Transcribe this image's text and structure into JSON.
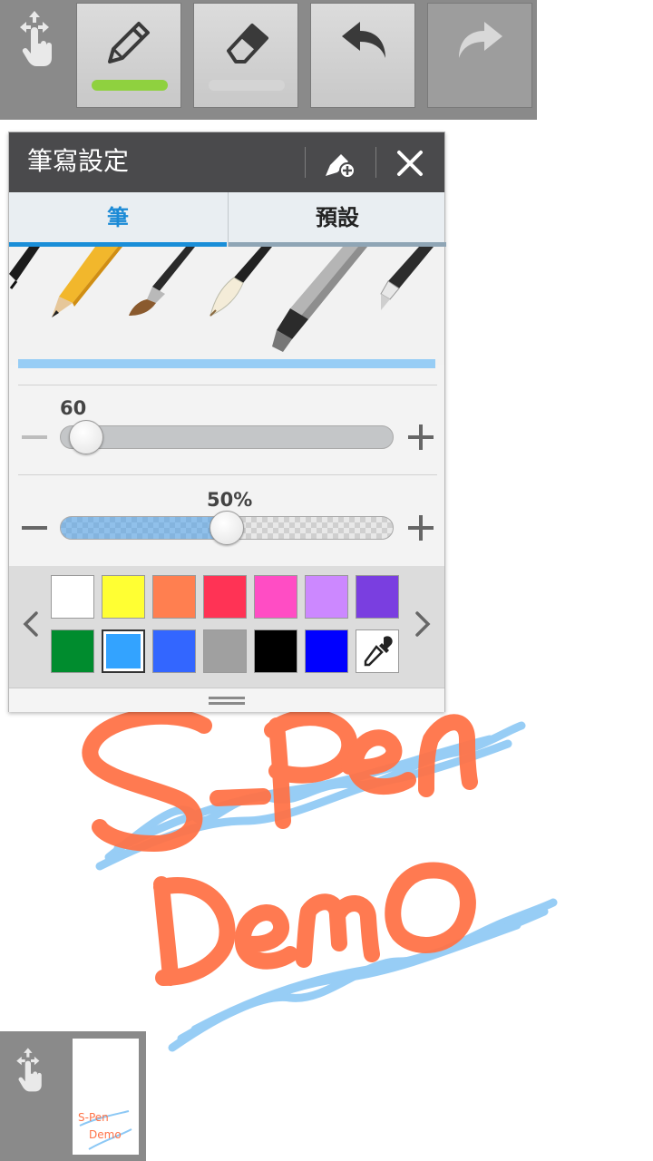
{
  "toolbar": {
    "items": [
      {
        "name": "move",
        "icon": "move-hand-icon"
      },
      {
        "name": "pen",
        "icon": "pencil-icon",
        "active": true,
        "indicator_color": "#8fd13f"
      },
      {
        "name": "eraser",
        "icon": "eraser-icon",
        "indicator_color": "#d4d4d4"
      },
      {
        "name": "undo",
        "icon": "undo-icon"
      },
      {
        "name": "redo",
        "icon": "redo-icon",
        "disabled": true
      }
    ]
  },
  "pen_panel": {
    "title": "筆寫設定",
    "header_icons": [
      "add-preset-icon",
      "close-icon"
    ],
    "tabs": [
      {
        "label": "筆",
        "active": true
      },
      {
        "label": "預設",
        "active": false
      }
    ],
    "pen_types": [
      "brush-pen",
      "pencil",
      "calligraphy-brush",
      "chinese-brush",
      "marker",
      "fine-marker"
    ],
    "selected_pen": "marker",
    "size": {
      "value": "60",
      "level": 0.04
    },
    "opacity": {
      "value": "50%",
      "level": 0.5
    },
    "palette": {
      "colors": [
        "#ffffff",
        "#ffff33",
        "#ff7f50",
        "#ff3355",
        "#ff4dc4",
        "#cc88ff",
        "#7a3ee0",
        "#008c2e",
        "#33a3ff",
        "#3366ff",
        "#a0a0a0",
        "#000000",
        "#0000ff"
      ],
      "selected_color": "#33a3ff",
      "eyedropper_icon": "eyedropper-icon",
      "prev_icon": "chevron-left-icon",
      "next_icon": "chevron-right-icon"
    }
  },
  "canvas": {
    "ink_colors": {
      "orange": "#ff7348",
      "blue": "#8cc8f5"
    }
  },
  "navigator": {
    "icon": "move-hand-icon",
    "thumbnail_text": [
      "S-Pen",
      "Demo"
    ]
  }
}
